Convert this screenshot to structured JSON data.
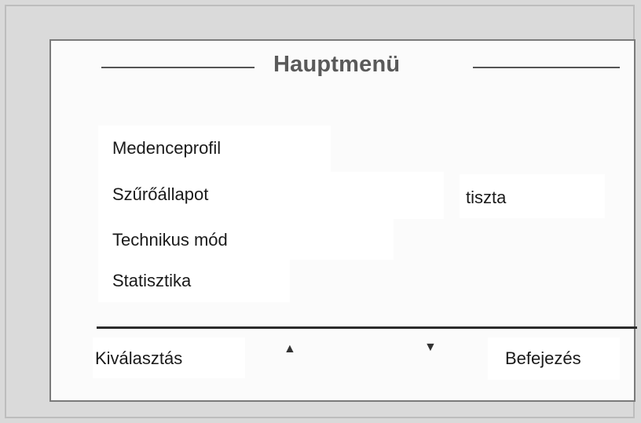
{
  "screen": {
    "title": "Hauptmenü"
  },
  "menu": {
    "items": [
      {
        "label": "Medenceprofil"
      },
      {
        "label": "Szűrőállapot",
        "value": "tiszta"
      },
      {
        "label": "Technikus mód"
      },
      {
        "label": "Statisztika"
      }
    ]
  },
  "softkeys": {
    "select_label": "Kiválasztás",
    "up_glyph": "▲",
    "down_glyph": "▼",
    "finish_label": "Befejezés"
  }
}
